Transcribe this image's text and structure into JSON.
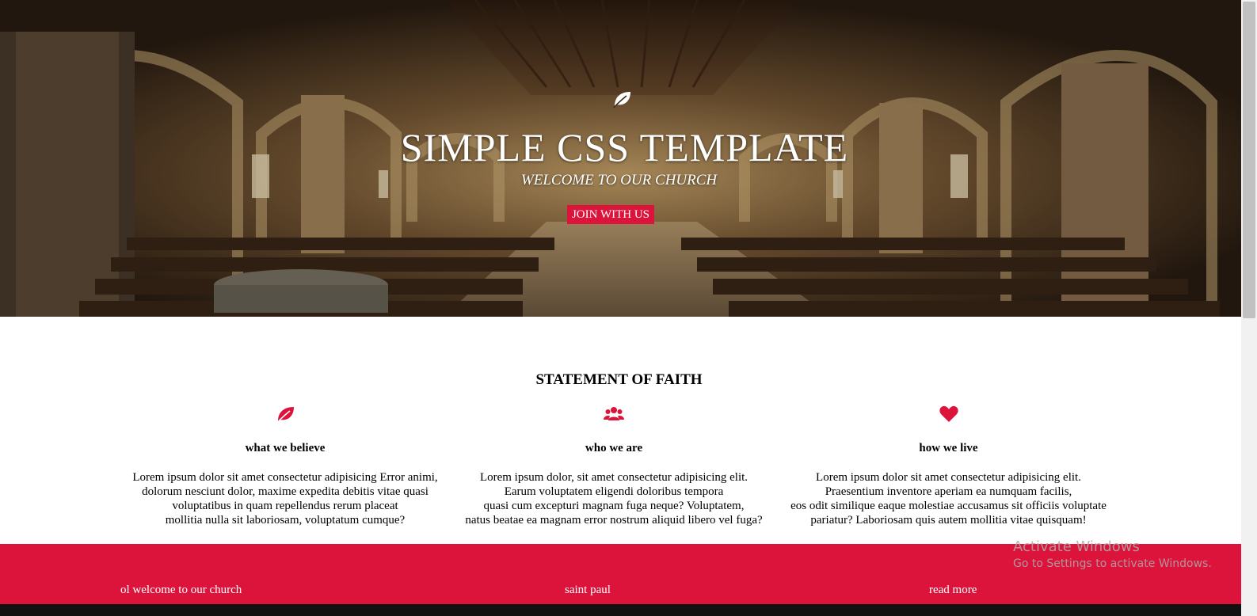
{
  "hero": {
    "icon": "leaf-icon",
    "title": "SIMPLE CSS TEMPLATE",
    "subtitle": "WELCOME TO OUR CHURCH",
    "button_label": "JOIN WITH US"
  },
  "statement": {
    "title": "STATEMENT OF FAITH",
    "columns": [
      {
        "icon": "leaf-icon",
        "heading": "what we believe",
        "lines": [
          "Lorem ipsum dolor sit amet consectetur adipisicing Error animi,",
          "dolorum nesciunt dolor, maxime expedita debitis vitae quasi",
          "voluptatibus in quam repellendus rerum placeat",
          "mollitia nulla sit laboriosam, voluptatum cumque?"
        ]
      },
      {
        "icon": "users-icon",
        "heading": "who we are",
        "lines": [
          "Lorem ipsum dolor, sit amet consectetur adipisicing elit.",
          "Earum voluptatem eligendi doloribus tempora",
          "quasi cum excepturi magnam fuga neque? Voluptatem,",
          "natus beatae ea magnam error nostrum aliquid libero vel fuga?"
        ]
      },
      {
        "icon": "heart-icon",
        "heading": "how we live",
        "lines": [
          "Lorem ipsum dolor sit amet consectetur adipisicing elit.",
          "Praesentium inventore aperiam ea numquam facilis,",
          "eos odit similique eaque molestiae accusamus sit officiis voluptate",
          "pariatur? Laboriosam quis autem mollitia vitae quisquam!"
        ]
      }
    ]
  },
  "footer": {
    "links": [
      "ol welcome to our church",
      "saint paul",
      "read more"
    ]
  },
  "watermark": {
    "line1": "Activate Windows",
    "line2": "Go to Settings to activate Windows."
  },
  "colors": {
    "accent": "#dc143c",
    "white": "#ffffff"
  }
}
